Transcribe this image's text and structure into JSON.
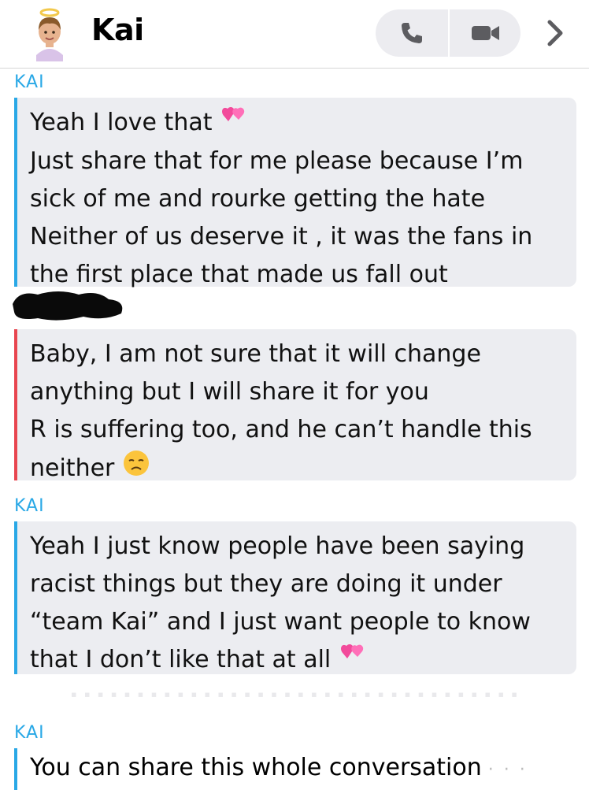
{
  "header": {
    "title": "Kai",
    "call_icon": "phone-icon",
    "video_icon": "video-camera-icon",
    "more_icon": "chevron-right-icon"
  },
  "colors": {
    "friend_accent": "#29a8e6",
    "me_accent": "#e8454f",
    "bubble_bg": "#ecedf1"
  },
  "messages": [
    {
      "sender": "KAI",
      "lines": [
        "Yeah I love that",
        "Just share that for me please because I’m",
        "sick of me and rourke getting the hate",
        "Neither of us deserve it , it was the fans in",
        "the first place that made us fall out"
      ]
    },
    {
      "sender": "",
      "lines": [
        "Baby, I am not sure that it will change",
        "anything but I will share it for you",
        "R is suffering too, and he can’t handle this",
        "neither"
      ]
    },
    {
      "sender": "KAI",
      "lines": [
        "Yeah I just know people have been saying",
        "racist things but they are doing it under",
        "“team Kai” and I just want people to know",
        "that I don’t like that at all"
      ]
    },
    {
      "sender": "KAI",
      "lines": [
        "You can share this whole conversation"
      ]
    }
  ]
}
